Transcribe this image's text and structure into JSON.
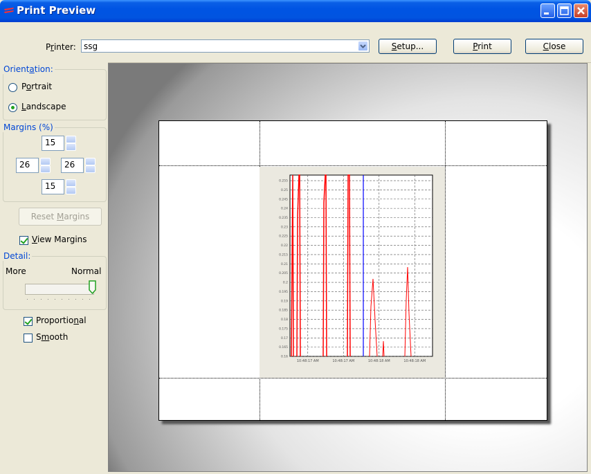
{
  "window": {
    "title": "Print Preview",
    "title_bar_color": "#0054e3"
  },
  "toolbar": {
    "printer_label": "Printer:",
    "printer_value": "ssg",
    "setup_label": "Setup...",
    "print_label": "Print",
    "close_label": "Close"
  },
  "orientation": {
    "title": "Orientation:",
    "portrait_label": "Portrait",
    "landscape_label": "Landscape",
    "selected": "Landscape"
  },
  "margins": {
    "title": "Margins (%)",
    "top": "15",
    "left": "26",
    "right": "26",
    "bottom": "15"
  },
  "reset_margins_label": "Reset Margins",
  "view_margins": {
    "label": "View Margins",
    "checked": true
  },
  "detail": {
    "title": "Detail:",
    "more_label": "More",
    "normal_label": "Normal",
    "level": 1.0
  },
  "proportional": {
    "label": "Proportional",
    "checked": true
  },
  "smooth": {
    "label": "Smooth",
    "checked": false
  },
  "icons": [
    "app-icon",
    "minimize-icon",
    "maximize-icon",
    "close-icon",
    "chevron-down-icon",
    "spin-up-icon",
    "spin-down-icon",
    "slider-thumb-icon"
  ],
  "chart_data": {
    "type": "line",
    "y_ticks": [
      "0.255",
      "0.25",
      "0.245",
      "0.24",
      "0.235",
      "0.23",
      "0.225",
      "0.22",
      "0.215",
      "0.21",
      "0.205",
      "0.2",
      "0.195",
      "0.19",
      "0.185",
      "0.18",
      "0.175",
      "0.17",
      "0.165",
      "0.16"
    ],
    "x_ticks": [
      "10:48:17 AM",
      "10:48:17 AM",
      "10:48:18 AM",
      "10:48:18 AM"
    ],
    "ylim": [
      0.16,
      0.258
    ],
    "grid": true,
    "series_colors": [
      "#ff0000",
      "#0000ff"
    ]
  }
}
